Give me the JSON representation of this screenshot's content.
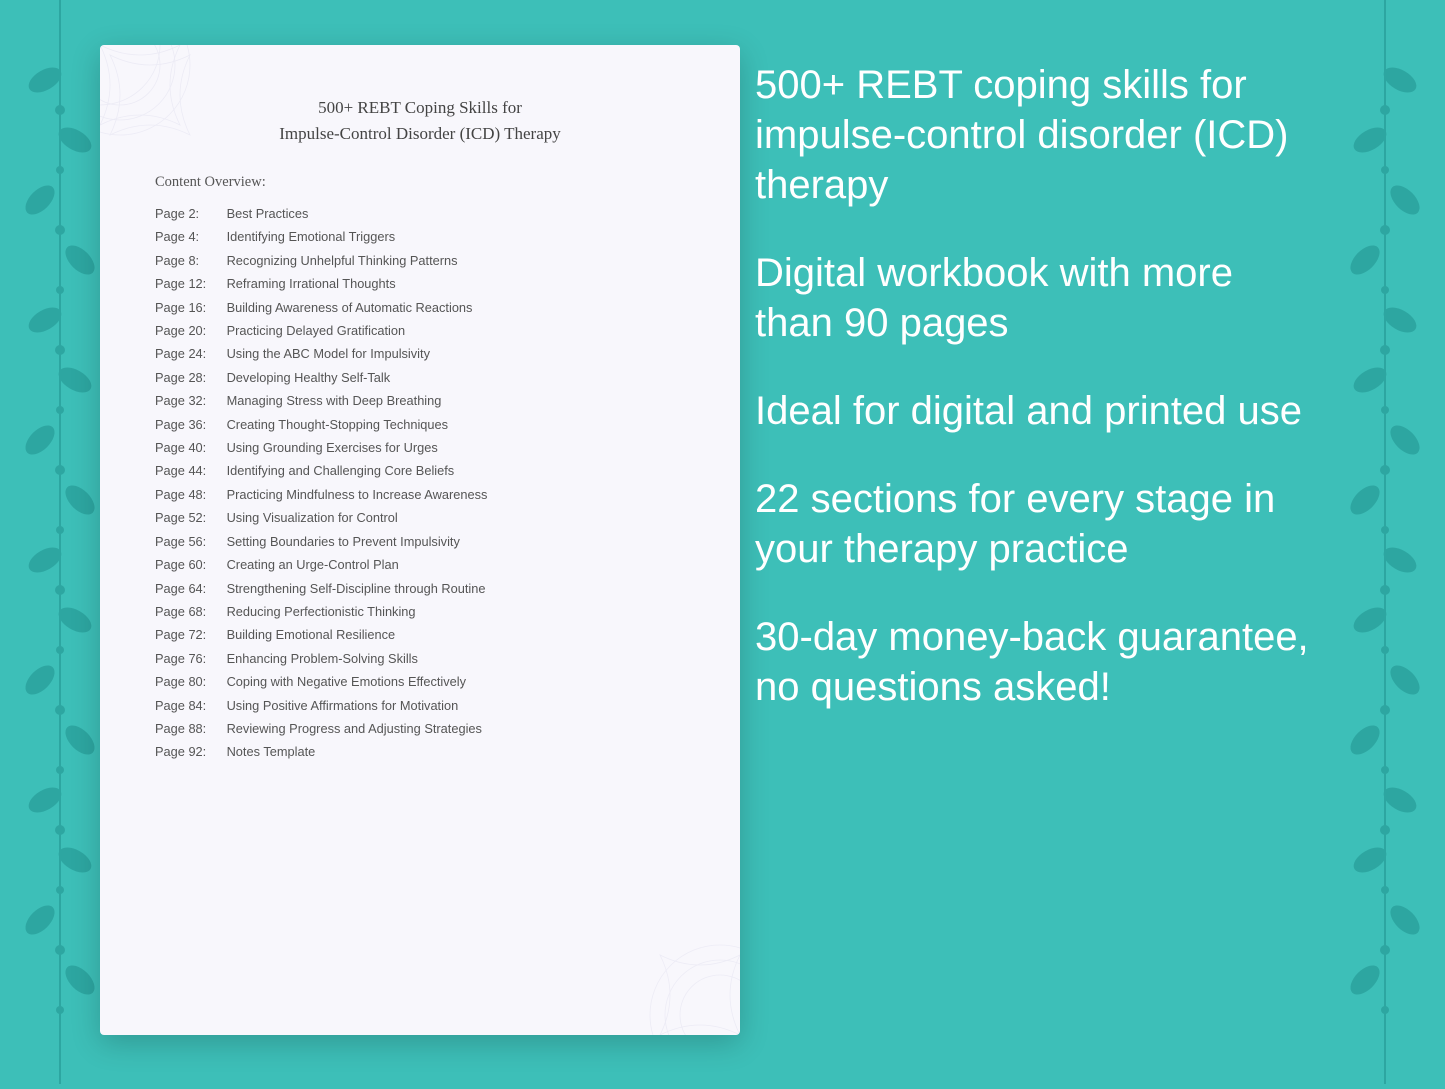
{
  "background_color": "#3dbfb8",
  "document": {
    "title_line1": "500+ REBT Coping Skills for",
    "title_line2": "Impulse-Control Disorder (ICD) Therapy",
    "overview_label": "Content Overview:",
    "toc_items": [
      {
        "page": "Page  2:",
        "title": "Best Practices"
      },
      {
        "page": "Page  4:",
        "title": "Identifying Emotional Triggers"
      },
      {
        "page": "Page  8:",
        "title": "Recognizing Unhelpful Thinking Patterns"
      },
      {
        "page": "Page 12:",
        "title": "Reframing Irrational Thoughts"
      },
      {
        "page": "Page 16:",
        "title": "Building Awareness of Automatic Reactions"
      },
      {
        "page": "Page 20:",
        "title": "Practicing Delayed Gratification"
      },
      {
        "page": "Page 24:",
        "title": "Using the ABC Model for Impulsivity"
      },
      {
        "page": "Page 28:",
        "title": "Developing Healthy Self-Talk"
      },
      {
        "page": "Page 32:",
        "title": "Managing Stress with Deep Breathing"
      },
      {
        "page": "Page 36:",
        "title": "Creating Thought-Stopping Techniques"
      },
      {
        "page": "Page 40:",
        "title": "Using Grounding Exercises for Urges"
      },
      {
        "page": "Page 44:",
        "title": "Identifying and Challenging Core Beliefs"
      },
      {
        "page": "Page 48:",
        "title": "Practicing Mindfulness to Increase Awareness"
      },
      {
        "page": "Page 52:",
        "title": "Using Visualization for Control"
      },
      {
        "page": "Page 56:",
        "title": "Setting Boundaries to Prevent Impulsivity"
      },
      {
        "page": "Page 60:",
        "title": "Creating an Urge-Control Plan"
      },
      {
        "page": "Page 64:",
        "title": "Strengthening Self-Discipline through Routine"
      },
      {
        "page": "Page 68:",
        "title": "Reducing Perfectionistic Thinking"
      },
      {
        "page": "Page 72:",
        "title": "Building Emotional Resilience"
      },
      {
        "page": "Page 76:",
        "title": "Enhancing Problem-Solving Skills"
      },
      {
        "page": "Page 80:",
        "title": "Coping with Negative Emotions Effectively"
      },
      {
        "page": "Page 84:",
        "title": "Using Positive Affirmations for Motivation"
      },
      {
        "page": "Page 88:",
        "title": "Reviewing Progress and Adjusting Strategies"
      },
      {
        "page": "Page 92:",
        "title": "Notes Template"
      }
    ]
  },
  "right_panel": {
    "bullet1": "500+ REBT coping skills for impulse-control disorder (ICD) therapy",
    "bullet2": "Digital workbook with more than 90 pages",
    "bullet3": "Ideal for digital and printed use",
    "bullet4": "22 sections for every stage in your therapy practice",
    "bullet5": "30-day money-back guarantee, no questions asked!"
  }
}
